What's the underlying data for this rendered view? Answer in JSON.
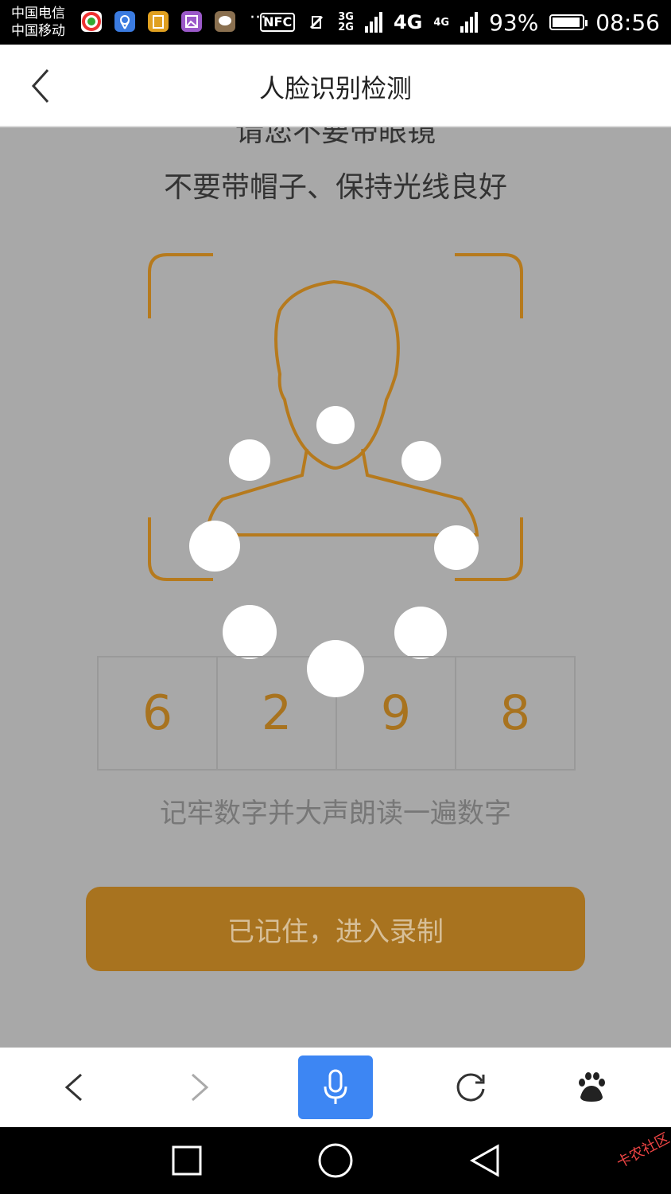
{
  "statusbar": {
    "carrier1": "中国电信",
    "carrier2": "中国移动",
    "more": "···",
    "nfc": "NFC",
    "net3g": "3G",
    "net2g": "2G",
    "net4g": "4G",
    "net4g_small": "4G",
    "battery_pct": "93%",
    "battery_fraction": 0.93,
    "time": "08:56",
    "icon_names": [
      "app-icon-multicolor",
      "map-pin-icon",
      "clipboard-icon",
      "gallery-icon",
      "chat-icon"
    ]
  },
  "header": {
    "title": "人脸识别检测",
    "back_icon": "chevron-left-icon"
  },
  "main": {
    "tip_line1": "请您不要带眼镜",
    "tip_line2": "不要带帽子、保持光线良好",
    "code_digits": [
      "6",
      "2",
      "9",
      "8"
    ],
    "hint": "记牢数字并大声朗读一遍数字",
    "confirm_button": "已记住，进入录制",
    "accent_color": "#a8731f"
  },
  "browserbar": {
    "items": [
      "back-icon",
      "forward-icon",
      "mic-icon",
      "refresh-icon",
      "baidu-paw-icon"
    ],
    "accent_color": "#3d86f3"
  },
  "navbar": {
    "items": [
      "square-recent-icon",
      "circle-home-icon",
      "triangle-back-icon"
    ]
  },
  "watermark": "卡农社区"
}
